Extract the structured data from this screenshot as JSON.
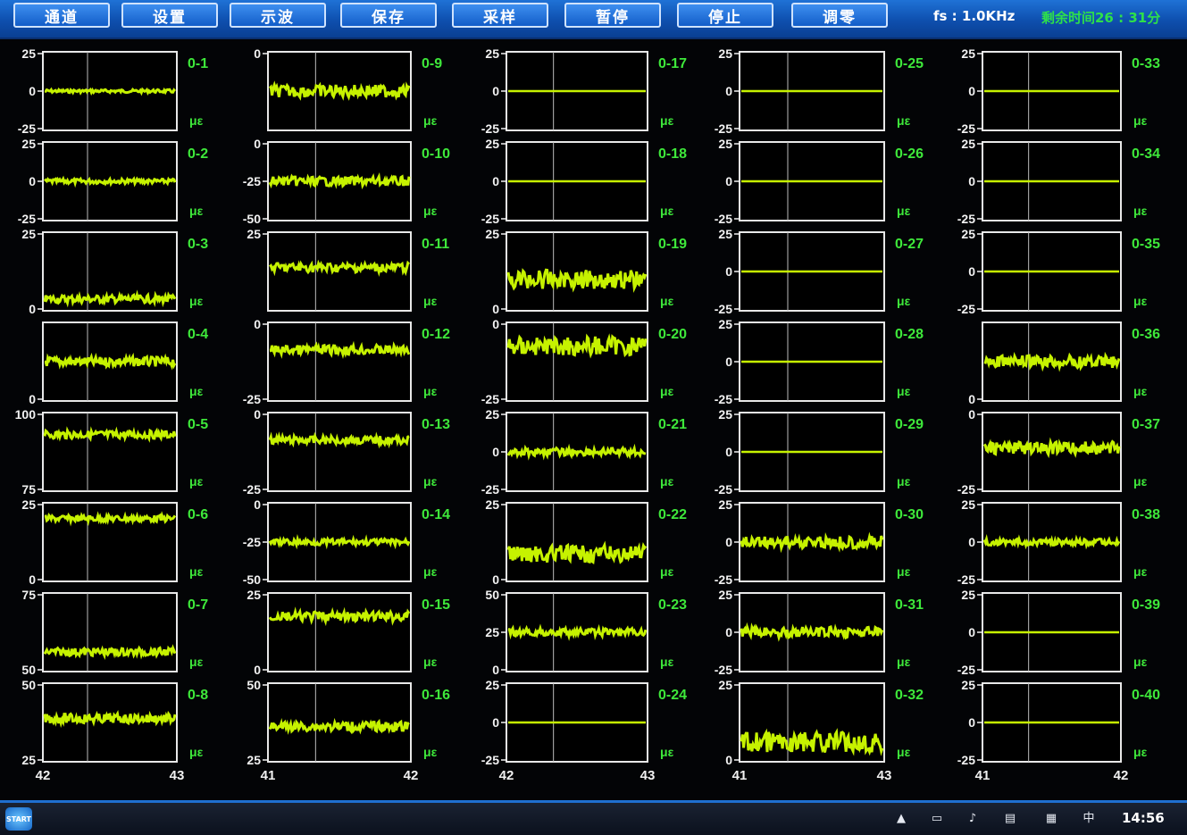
{
  "toolbar": {
    "buttons": [
      "通道",
      "设置",
      "示波",
      "保存",
      "采样",
      "暂停",
      "停止",
      "调零"
    ],
    "sample_rate": "fs : 1.0KHz",
    "remaining_time": "剩余时间26 : 31分"
  },
  "colors": {
    "toolbar": "#1558c0",
    "plot_frame": "#e8e8e8",
    "grid": "#bdbdbd",
    "trace": "#c6f200",
    "channel_label": "#3ee83a",
    "axis_text": "#f2f2f2"
  },
  "unit_label": "με",
  "columns": [
    {
      "channels": [
        {
          "label": "0-1",
          "ticks": [
            "25",
            "0",
            "-25"
          ],
          "level": 0.5,
          "amp": 0.02
        },
        {
          "label": "0-2",
          "ticks": [
            "25",
            "0",
            "-25"
          ],
          "level": 0.5,
          "amp": 0.03
        },
        {
          "label": "0-3",
          "ticks": [
            "25",
            "",
            "0"
          ],
          "level": 0.15,
          "amp": 0.05
        },
        {
          "label": "0-4",
          "ticks": [
            "",
            "",
            "0"
          ],
          "level": 0.5,
          "amp": 0.06
        },
        {
          "label": "0-5",
          "ticks": [
            "100",
            "",
            "75"
          ],
          "level": 0.72,
          "amp": 0.05
        },
        {
          "label": "0-6",
          "ticks": [
            "25",
            "",
            "0"
          ],
          "level": 0.8,
          "amp": 0.04
        },
        {
          "label": "0-7",
          "ticks": [
            "75",
            "",
            "50"
          ],
          "level": 0.25,
          "amp": 0.05
        },
        {
          "label": "0-8",
          "ticks": [
            "50",
            "",
            "25"
          ],
          "level": 0.55,
          "amp": 0.06
        }
      ],
      "xticks": [
        "42",
        "43"
      ]
    },
    {
      "channels": [
        {
          "label": "0-9",
          "ticks": [
            "0",
            "",
            ""
          ],
          "level": 0.5,
          "amp": 0.08
        },
        {
          "label": "0-10",
          "ticks": [
            "0",
            "-25",
            "-50"
          ],
          "level": 0.5,
          "amp": 0.06
        },
        {
          "label": "0-11",
          "ticks": [
            "25",
            "",
            ""
          ],
          "level": 0.55,
          "amp": 0.06
        },
        {
          "label": "0-12",
          "ticks": [
            "0",
            "",
            "-25"
          ],
          "level": 0.65,
          "amp": 0.06
        },
        {
          "label": "0-13",
          "ticks": [
            "0",
            "",
            "-25"
          ],
          "level": 0.65,
          "amp": 0.05
        },
        {
          "label": "0-14",
          "ticks": [
            "0",
            "-25",
            "-50"
          ],
          "level": 0.5,
          "amp": 0.04
        },
        {
          "label": "0-15",
          "ticks": [
            "25",
            "",
            "0"
          ],
          "level": 0.7,
          "amp": 0.06
        },
        {
          "label": "0-16",
          "ticks": [
            "50",
            "",
            "25"
          ],
          "level": 0.45,
          "amp": 0.06
        }
      ],
      "xticks": [
        "41",
        "42"
      ]
    },
    {
      "channels": [
        {
          "label": "0-17",
          "ticks": [
            "25",
            "0",
            "-25"
          ],
          "level": 0.5,
          "amp": 0.0
        },
        {
          "label": "0-18",
          "ticks": [
            "25",
            "0",
            "-25"
          ],
          "level": 0.5,
          "amp": 0.0
        },
        {
          "label": "0-19",
          "ticks": [
            "25",
            "",
            "0"
          ],
          "level": 0.4,
          "amp": 0.12
        },
        {
          "label": "0-20",
          "ticks": [
            "0",
            "",
            "-25"
          ],
          "level": 0.7,
          "amp": 0.12
        },
        {
          "label": "0-21",
          "ticks": [
            "25",
            "0",
            "-25"
          ],
          "level": 0.5,
          "amp": 0.05
        },
        {
          "label": "0-22",
          "ticks": [
            "25",
            "",
            "0"
          ],
          "level": 0.35,
          "amp": 0.11
        },
        {
          "label": "0-23",
          "ticks": [
            "50",
            "25",
            "0"
          ],
          "level": 0.5,
          "amp": 0.05
        },
        {
          "label": "0-24",
          "ticks": [
            "25",
            "0",
            "-25"
          ],
          "level": 0.5,
          "amp": 0.0
        }
      ],
      "xticks": [
        "42",
        "43"
      ]
    },
    {
      "channels": [
        {
          "label": "0-25",
          "ticks": [
            "25",
            "0",
            "-25"
          ],
          "level": 0.5,
          "amp": 0.0
        },
        {
          "label": "0-26",
          "ticks": [
            "25",
            "0",
            "-25"
          ],
          "level": 0.5,
          "amp": 0.0
        },
        {
          "label": "0-27",
          "ticks": [
            "25",
            "0",
            "-25"
          ],
          "level": 0.5,
          "amp": 0.0
        },
        {
          "label": "0-28",
          "ticks": [
            "25",
            "0",
            "-25"
          ],
          "level": 0.5,
          "amp": 0.0
        },
        {
          "label": "0-29",
          "ticks": [
            "25",
            "0",
            "-25"
          ],
          "level": 0.5,
          "amp": 0.0
        },
        {
          "label": "0-30",
          "ticks": [
            "25",
            "0",
            "-25"
          ],
          "level": 0.5,
          "amp": 0.08
        },
        {
          "label": "0-31",
          "ticks": [
            "25",
            "0",
            "-25"
          ],
          "level": 0.5,
          "amp": 0.07
        },
        {
          "label": "0-32",
          "ticks": [
            "25",
            "",
            "0"
          ],
          "level": 0.25,
          "amp": 0.13
        }
      ],
      "xticks": [
        "41",
        "43"
      ]
    },
    {
      "channels": [
        {
          "label": "0-33",
          "ticks": [
            "25",
            "0",
            "-25"
          ],
          "level": 0.5,
          "amp": 0.0
        },
        {
          "label": "0-34",
          "ticks": [
            "25",
            "0",
            "-25"
          ],
          "level": 0.5,
          "amp": 0.0
        },
        {
          "label": "0-35",
          "ticks": [
            "25",
            "0",
            "-25"
          ],
          "level": 0.5,
          "amp": 0.0
        },
        {
          "label": "0-36",
          "ticks": [
            "",
            "",
            "0"
          ],
          "level": 0.5,
          "amp": 0.08
        },
        {
          "label": "0-37",
          "ticks": [
            "0",
            "",
            "-25"
          ],
          "level": 0.55,
          "amp": 0.08
        },
        {
          "label": "0-38",
          "ticks": [
            "25",
            "0",
            "-25"
          ],
          "level": 0.5,
          "amp": 0.04
        },
        {
          "label": "0-39",
          "ticks": [
            "25",
            "0",
            "-25"
          ],
          "level": 0.5,
          "amp": 0.0
        },
        {
          "label": "0-40",
          "ticks": [
            "25",
            "0",
            "-25"
          ],
          "level": 0.5,
          "amp": 0.0
        }
      ],
      "xticks": [
        "41",
        "42"
      ]
    }
  ],
  "taskbar": {
    "start_label": "START",
    "clock": "14:56",
    "tray_icons": [
      "up-arrow-icon",
      "window-icon",
      "volume-icon",
      "document-icon",
      "keyboard-icon",
      "ime-icon"
    ],
    "ime_label": "中"
  }
}
